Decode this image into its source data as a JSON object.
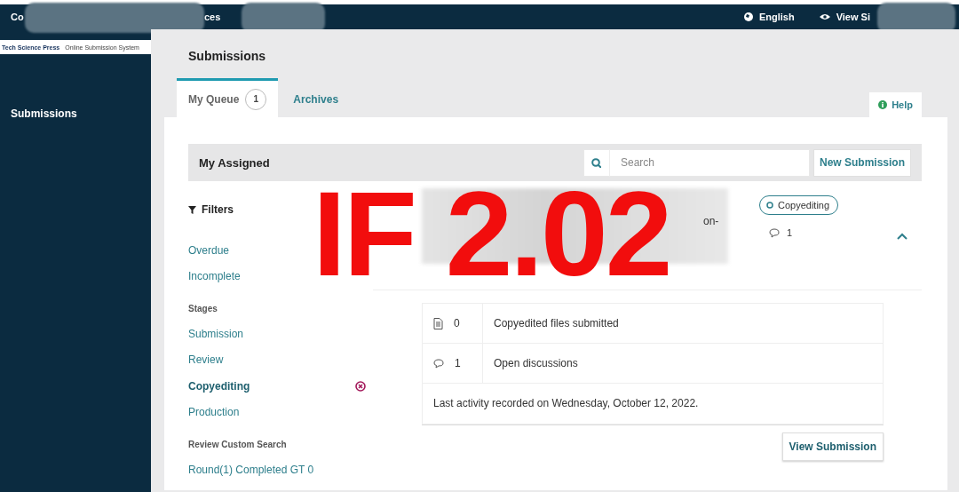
{
  "topbar": {
    "fragments": [
      "Co",
      "ces"
    ],
    "language": "English",
    "view_site": "View Si"
  },
  "sidebar": {
    "logo": {
      "name": "Tech Science Press",
      "subtitle": "Online Submission System"
    },
    "items": [
      {
        "label": "Submissions",
        "selected": true
      }
    ]
  },
  "page": {
    "title": "Submissions",
    "help": "Help"
  },
  "tabs": [
    {
      "label": "My Queue",
      "count": "1",
      "selected": true
    },
    {
      "label": "Archives",
      "selected": false
    }
  ],
  "list": {
    "title": "My Assigned",
    "search": {
      "placeholder": "Search"
    },
    "new_button": "New Submission"
  },
  "filters": {
    "title": "Filters",
    "groups": [
      {
        "items": [
          {
            "label": "Overdue",
            "selected": false
          },
          {
            "label": "Incomplete",
            "selected": false
          }
        ]
      },
      {
        "heading": "Stages",
        "items": [
          {
            "label": "Submission",
            "selected": false
          },
          {
            "label": "Review",
            "selected": false
          },
          {
            "label": "Copyediting",
            "selected": true
          },
          {
            "label": "Production",
            "selected": false
          }
        ]
      },
      {
        "heading": "Review Custom Search",
        "items": [
          {
            "label": "Round(1) Completed GT 0",
            "selected": false
          }
        ]
      }
    ]
  },
  "submission": {
    "title_fragment": "on-",
    "stage": "Copyediting",
    "discussions": "1",
    "expanded": true,
    "details": [
      {
        "kind": "files",
        "count": "0",
        "label": "Copyedited files submitted"
      },
      {
        "kind": "discussions",
        "count": "1",
        "label": "Open discussions"
      }
    ],
    "last_activity": "Last activity recorded on Wednesday, October 12, 2022.",
    "view_button": "View Submission"
  },
  "overlay": {
    "text": "IF 2.02"
  }
}
